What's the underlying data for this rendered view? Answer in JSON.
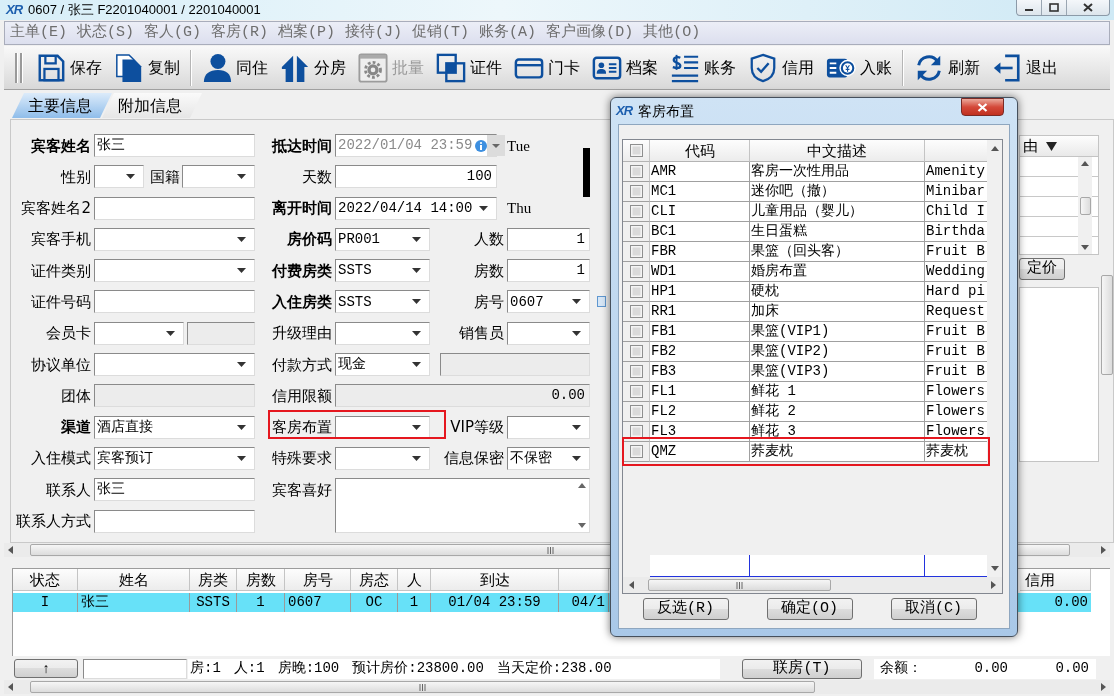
{
  "window": {
    "logo": "XR",
    "title": "0607 / 张三 F2201040001 / 2201040001"
  },
  "menu": [
    "主单(E)",
    "状态(S)",
    "客人(G)",
    "客房(R)",
    "档案(P)",
    "接待(J)",
    "促销(T)",
    "账务(A)",
    "客户画像(D)",
    "其他(O)"
  ],
  "toolbar": [
    {
      "kind": "button",
      "label": "保存",
      "disabled": false
    },
    {
      "kind": "button",
      "label": "复制",
      "disabled": false
    },
    {
      "kind": "separator"
    },
    {
      "kind": "button",
      "label": "同住",
      "disabled": false
    },
    {
      "kind": "button",
      "label": "分房",
      "disabled": false
    },
    {
      "kind": "button",
      "label": "批量",
      "disabled": true
    },
    {
      "kind": "button",
      "label": "证件",
      "disabled": false
    },
    {
      "kind": "button",
      "label": "门卡",
      "disabled": false
    },
    {
      "kind": "button",
      "label": "档案",
      "disabled": false
    },
    {
      "kind": "button",
      "label": "账务",
      "disabled": false
    },
    {
      "kind": "button",
      "label": "信用",
      "disabled": false
    },
    {
      "kind": "button",
      "label": "入账",
      "disabled": false
    },
    {
      "kind": "separator"
    },
    {
      "kind": "button",
      "label": "刷新",
      "disabled": false
    },
    {
      "kind": "button",
      "label": "退出",
      "disabled": false
    }
  ],
  "tabs": [
    {
      "label": "主要信息",
      "selected": true
    },
    {
      "label": "附加信息",
      "selected": false
    }
  ],
  "form": {
    "rows": [
      {
        "left": [
          {
            "label": "宾客姓名",
            "kind": "text",
            "value": "张三",
            "emphasized": true,
            "disabled": false,
            "highlighted": false
          }
        ],
        "right": [
          {
            "label": "抵达时间",
            "kind": "datetime",
            "value": "2022/01/04 23:59",
            "note": "Tue",
            "emphasized": true,
            "disabled": true,
            "highlighted": false
          }
        ]
      },
      {
        "left": [
          {
            "label": "性别",
            "kind": "select",
            "emphasized": false,
            "disabled": false,
            "highlighted": false
          },
          {
            "label": "国籍",
            "kind": "select",
            "emphasized": false,
            "disabled": false,
            "highlighted": false
          }
        ],
        "right": [
          {
            "label": "天数",
            "kind": "number",
            "value": "100",
            "emphasized": false,
            "disabled": false,
            "highlighted": false
          }
        ]
      },
      {
        "left": [
          {
            "label": "宾客姓名2",
            "kind": "text",
            "emphasized": false,
            "disabled": false,
            "highlighted": false
          }
        ],
        "right": [
          {
            "label": "离开时间",
            "kind": "datetime",
            "value": "2022/04/14 14:00",
            "note": "Thu",
            "emphasized": true,
            "disabled": false,
            "highlighted": false
          }
        ]
      },
      {
        "left": [
          {
            "label": "宾客手机",
            "kind": "select",
            "emphasized": false,
            "disabled": false,
            "highlighted": false
          }
        ],
        "right": [
          {
            "label": "房价码",
            "kind": "select",
            "value": "PR001",
            "emphasized": true,
            "disabled": false,
            "highlighted": false
          },
          {
            "label": "人数",
            "kind": "number",
            "value": "1",
            "emphasized": false,
            "disabled": false,
            "highlighted": false
          }
        ]
      },
      {
        "left": [
          {
            "label": "证件类别",
            "kind": "select",
            "emphasized": false,
            "disabled": false,
            "highlighted": false
          }
        ],
        "right": [
          {
            "label": "付费房类",
            "kind": "select",
            "value": "SSTS",
            "emphasized": true,
            "disabled": false,
            "highlighted": false
          },
          {
            "label": "房数",
            "kind": "number",
            "value": "1",
            "emphasized": false,
            "disabled": false,
            "highlighted": false
          }
        ]
      },
      {
        "left": [
          {
            "label": "证件号码",
            "kind": "text",
            "emphasized": false,
            "disabled": false,
            "highlighted": false
          }
        ],
        "right": [
          {
            "label": "入住房类",
            "kind": "select",
            "value": "SSTS",
            "emphasized": true,
            "disabled": false,
            "highlighted": false
          },
          {
            "label": "房号",
            "kind": "select",
            "value": "0607",
            "emphasized": false,
            "disabled": false,
            "highlighted": false
          }
        ]
      },
      {
        "left": [
          {
            "label": "会员卡",
            "kind": "select",
            "emphasized": false,
            "disabled": false,
            "highlighted": false
          },
          {
            "kind": "text",
            "disabled": true,
            "highlighted": false
          }
        ],
        "right": [
          {
            "label": "升级理由",
            "kind": "select",
            "emphasized": false,
            "disabled": false,
            "highlighted": false
          },
          {
            "label": "销售员",
            "kind": "select",
            "emphasized": false,
            "disabled": false,
            "highlighted": false
          }
        ]
      },
      {
        "left": [
          {
            "label": "协议单位",
            "kind": "select",
            "emphasized": false,
            "disabled": false,
            "highlighted": false
          }
        ],
        "right": [
          {
            "label": "付款方式",
            "kind": "select",
            "value": "现金",
            "emphasized": false,
            "disabled": false,
            "highlighted": false
          },
          {
            "kind": "text",
            "disabled": true,
            "highlighted": false
          }
        ]
      },
      {
        "left": [
          {
            "label": "团体",
            "kind": "text",
            "emphasized": false,
            "disabled": true,
            "highlighted": false
          }
        ],
        "right": [
          {
            "label": "信用限额",
            "kind": "number",
            "value": "0.00",
            "emphasized": false,
            "disabled": true,
            "highlighted": false
          }
        ]
      },
      {
        "left": [
          {
            "label": "渠道",
            "kind": "select",
            "value": "酒店直接",
            "emphasized": true,
            "disabled": false,
            "highlighted": false
          }
        ],
        "right": [
          {
            "label": "客房布置",
            "kind": "select",
            "emphasized": false,
            "disabled": false,
            "highlighted": true
          },
          {
            "label": "VIP等级",
            "kind": "select",
            "emphasized": false,
            "disabled": false,
            "highlighted": false
          }
        ]
      },
      {
        "left": [
          {
            "label": "入住模式",
            "kind": "select",
            "value": "宾客预订",
            "emphasized": false,
            "disabled": false,
            "highlighted": false
          }
        ],
        "right": [
          {
            "label": "特殊要求",
            "kind": "select",
            "emphasized": false,
            "disabled": false,
            "highlighted": false
          },
          {
            "label": "信息保密",
            "kind": "select",
            "value": "不保密",
            "emphasized": false,
            "disabled": false,
            "highlighted": false
          }
        ]
      },
      {
        "left": [
          {
            "label": "联系人",
            "kind": "text",
            "value": "张三",
            "emphasized": false,
            "disabled": false,
            "highlighted": false
          }
        ],
        "right": [
          {
            "label": "宾客喜好",
            "kind": "textarea",
            "emphasized": false,
            "disabled": false,
            "highlighted": false
          }
        ]
      },
      {
        "left": [
          {
            "label": "联系人方式",
            "kind": "text",
            "emphasized": false,
            "disabled": false,
            "highlighted": false
          }
        ]
      }
    ]
  },
  "side_panel": {
    "column_header": "由",
    "button": "定价"
  },
  "guest_table": {
    "columns": [
      "状态",
      "姓名",
      "房类",
      "房数",
      "房号",
      "房态",
      "人",
      "到达"
    ],
    "trailing_column": "信用",
    "rows": [
      {
        "selected": true,
        "cells": [
          "I",
          "张三",
          "SSTS",
          "1",
          "0607",
          "OC",
          "1",
          "01/04 23:59"
        ],
        "column_9": "04/1",
        "trailing_cell": "0.00"
      }
    ]
  },
  "status_bar": {
    "up_button": "↑",
    "summary": [
      "房:1",
      "人:1",
      "房晚:100",
      "预计房价:23800.00",
      "当天定价:238.00"
    ],
    "link_button": "联房(T)",
    "balance_label": "余额：",
    "balances": [
      "0.00",
      "0.00"
    ]
  },
  "popup": {
    "logo": "XR",
    "title": "客房布置",
    "all_checked": false,
    "columns": [
      "代码",
      "中文描述"
    ],
    "rows": [
      {
        "checked": false,
        "code": "AMR",
        "name": "客房一次性用品",
        "column_3": "Amenity",
        "highlighted": false
      },
      {
        "checked": false,
        "code": "MC1",
        "name": "迷你吧（撤）",
        "column_3": "Minibar",
        "highlighted": false
      },
      {
        "checked": false,
        "code": "CLI",
        "name": "儿童用品（婴儿）",
        "column_3": "Child I",
        "highlighted": false
      },
      {
        "checked": false,
        "code": "BC1",
        "name": "生日蛋糕",
        "column_3": "Birthda",
        "highlighted": false
      },
      {
        "checked": false,
        "code": "FBR",
        "name": "果篮（回头客）",
        "column_3": "Fruit B",
        "highlighted": false
      },
      {
        "checked": false,
        "code": "WD1",
        "name": "婚房布置",
        "column_3": "Wedding",
        "highlighted": false
      },
      {
        "checked": false,
        "code": "HP1",
        "name": "硬枕",
        "column_3": "Hard pi",
        "highlighted": false
      },
      {
        "checked": false,
        "code": "RR1",
        "name": "加床",
        "column_3": "Request",
        "highlighted": false
      },
      {
        "checked": false,
        "code": "FB1",
        "name": "果篮(VIP1)",
        "column_3": "Fruit B",
        "highlighted": false
      },
      {
        "checked": false,
        "code": "FB2",
        "name": "果篮(VIP2)",
        "column_3": "Fruit B",
        "highlighted": false
      },
      {
        "checked": false,
        "code": "FB3",
        "name": "果篮(VIP3)",
        "column_3": "Fruit B",
        "highlighted": false
      },
      {
        "checked": false,
        "code": "FL1",
        "name": "鲜花 1",
        "column_3": "Flowers",
        "highlighted": false
      },
      {
        "checked": false,
        "code": "FL2",
        "name": "鲜花 2",
        "column_3": "Flowers",
        "highlighted": false
      },
      {
        "checked": false,
        "code": "FL3",
        "name": "鲜花 3",
        "column_3": "Flowers",
        "highlighted": false
      },
      {
        "checked": false,
        "code": "QMZ",
        "name": "荞麦枕",
        "column_3": "荞麦枕",
        "highlighted": true
      }
    ],
    "buttons": [
      "反选(R)",
      "确定(O)",
      "取消(C)"
    ]
  }
}
